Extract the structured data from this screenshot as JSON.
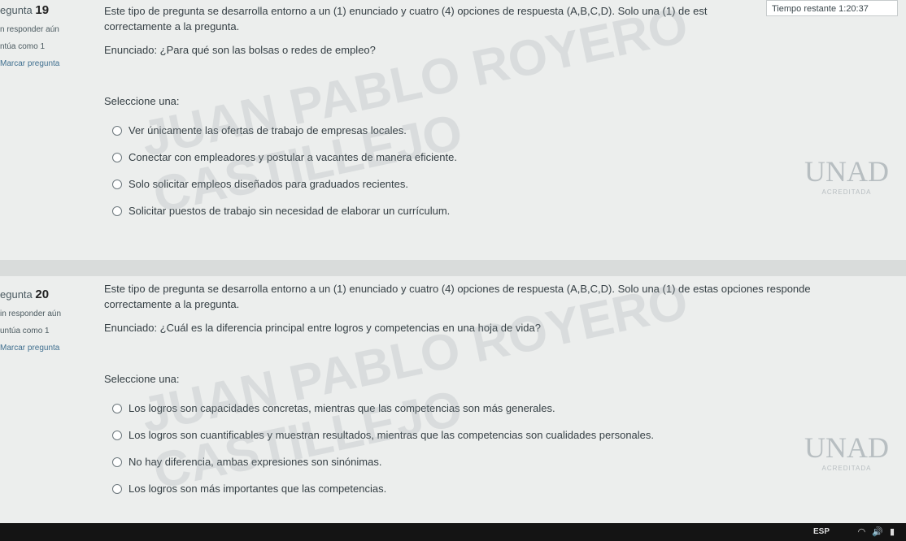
{
  "timer": {
    "label": "Tiempo restante",
    "value": "1:20:37"
  },
  "questions": [
    {
      "number_label": "egunta",
      "number": "19",
      "status": "n responder aún",
      "score": "ntúa como 1",
      "flag": "Marcar pregunta",
      "intro_line1": "Este tipo de pregunta se desarrolla entorno a un (1) enunciado y cuatro (4) opciones de respuesta (A,B,C,D). Solo una (1) de est",
      "intro_line2": "correctamente a la pregunta.",
      "stem": "Enunciado: ¿Para qué son las bolsas o redes de empleo?",
      "select_label": "Seleccione una:",
      "options": [
        "Ver únicamente las ofertas de trabajo de empresas locales.",
        "Conectar con empleadores y postular a vacantes de manera eficiente.",
        "Solo solicitar empleos diseñados para graduados recientes.",
        "Solicitar puestos de trabajo sin necesidad de elaborar un currículum."
      ]
    },
    {
      "number_label": "egunta",
      "number": "20",
      "status": "in responder aún",
      "score": "untúa como 1",
      "flag": "Marcar pregunta",
      "intro_line1": "Este tipo de pregunta se desarrolla entorno a un (1) enunciado y cuatro (4) opciones de respuesta (A,B,C,D). Solo una (1) de estas opciones responde",
      "intro_line2": "correctamente a la pregunta.",
      "stem": "Enunciado: ¿Cuál es la diferencia principal entre logros y competencias en una hoja de vida?",
      "select_label": "Seleccione una:",
      "options": [
        "Los logros son capacidades concretas, mientras que las competencias son más generales.",
        "Los logros son cuantificables y muestran resultados, mientras que las competencias son cualidades personales.",
        "No hay diferencia, ambas expresiones son sinónimas.",
        "Los logros son más importantes que las competencias."
      ]
    }
  ],
  "watermark": {
    "line1": "JUAN PABLO ROYERO",
    "line2": "CASTILLEJO"
  },
  "logo": {
    "mark": "UNAD",
    "sub": "ACREDITADA"
  },
  "taskbar": {
    "lang": "ESP"
  }
}
